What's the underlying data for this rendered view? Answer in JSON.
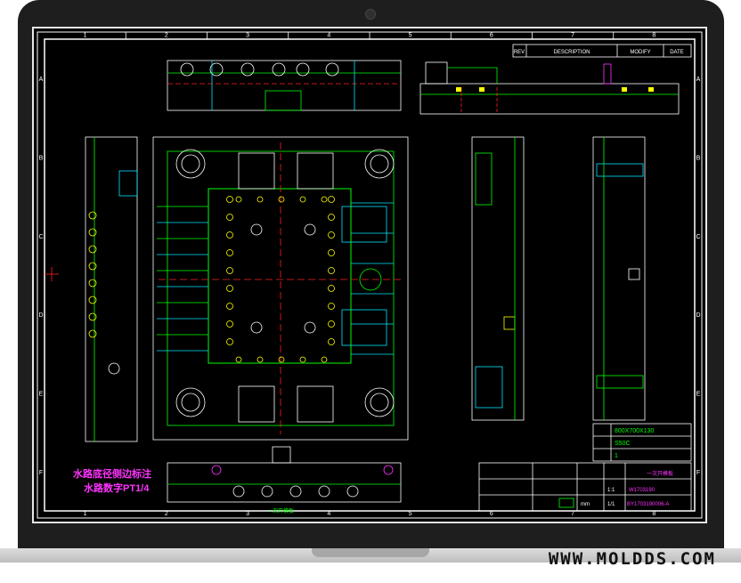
{
  "site": {
    "watermark": "WWW.MOLDDS.COM"
  },
  "drawing": {
    "columns": [
      "1",
      "2",
      "3",
      "4",
      "5",
      "6",
      "7",
      "8"
    ],
    "rows": [
      "A",
      "B",
      "C",
      "D",
      "E",
      "F"
    ],
    "revision_headers": [
      "REV",
      "DESCRIPTION",
      "MODIFY",
      "DATE"
    ],
    "notes": [
      "水路底径侧边标注",
      "水路数字PT1/4"
    ],
    "info_rows": [
      "800X700X130",
      "S50C",
      "1"
    ],
    "title_cells": {
      "name": "一次开模板",
      "drawing_no": "W1703190",
      "part_no": "BY1703190006-A",
      "scale": "1:1",
      "sheet": "1/1",
      "unit": "mm"
    },
    "bottom_label": "一次开模板"
  },
  "colors": {
    "bezel": "#1e1e1e",
    "cad_bg": "#000000",
    "frame": "#ffffff",
    "green": "#00ff00",
    "cyan": "#00e5ff",
    "magenta": "#ff33ff",
    "red": "#ff2020",
    "yellow": "#ffff00"
  },
  "icons": [
    "camera-icon",
    "center-cross-icon"
  ]
}
